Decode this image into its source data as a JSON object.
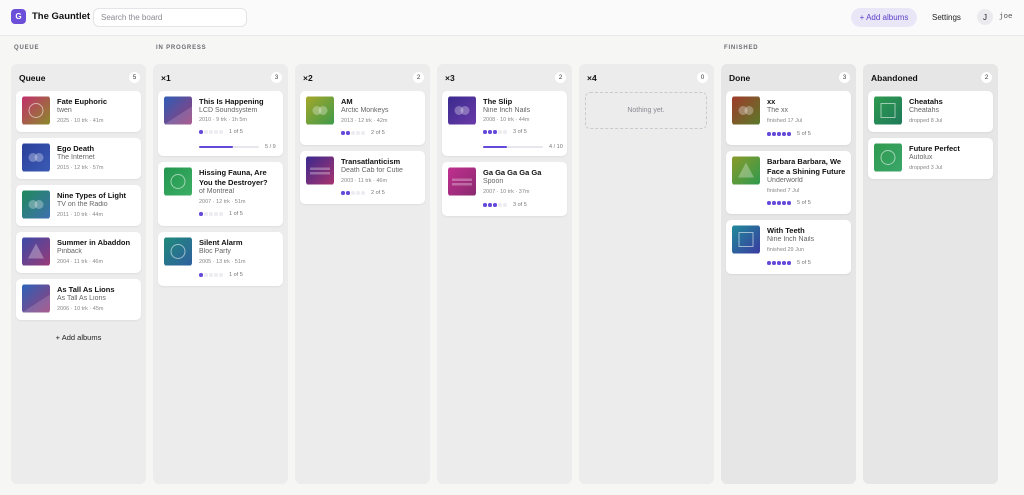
{
  "header": {
    "logo_letter": "G",
    "title": "The Gauntlet",
    "search_placeholder": "Search the board",
    "add_albums": "+ Add albums",
    "settings": "Settings",
    "avatar_letter": "J",
    "username": "joe"
  },
  "sections": {
    "queue": "QUEUE",
    "in_progress": "IN PROGRESS",
    "finished": "FINISHED"
  },
  "columns": {
    "queue": {
      "title": "Queue",
      "count": "5",
      "add_link": "+ Add albums",
      "cards": [
        {
          "title": "Fate Euphoric",
          "artist": "twen",
          "meta": "2025 · 10 trk · 41m"
        },
        {
          "title": "Ego Death",
          "artist": "The Internet",
          "meta": "2015 · 12 trk · 57m"
        },
        {
          "title": "Nine Types of Light",
          "artist": "TV on the Radio",
          "meta": "2011 · 10 trk · 44m"
        },
        {
          "title": "Summer in Abaddon",
          "artist": "Pinback",
          "meta": "2004 · 11 trk · 46m"
        },
        {
          "title": "As Tall As Lions",
          "artist": "As Tall As Lions",
          "meta": "2006 · 10 trk · 45m"
        }
      ]
    },
    "x1": {
      "title": "×1",
      "count": "3",
      "cards": [
        {
          "title": "This Is Happening",
          "artist": "LCD Soundsystem",
          "meta": "2010 · 9 trk · 1h 5m",
          "rating": 1,
          "rating_label": "1 of 5",
          "progress": 0.56,
          "progress_label": "5 / 9"
        },
        {
          "title": "Hissing Fauna, Are You the Destroyer?",
          "artist": "of Montreal",
          "meta": "2007 · 12 trk · 51m",
          "rating": 1,
          "rating_label": "1 of 5"
        },
        {
          "title": "Silent Alarm",
          "artist": "Bloc Party",
          "meta": "2005 · 13 trk · 51m",
          "rating": 1,
          "rating_label": "1 of 5"
        }
      ]
    },
    "x2": {
      "title": "×2",
      "count": "2",
      "cards": [
        {
          "title": "AM",
          "artist": "Arctic Monkeys",
          "meta": "2013 · 12 trk · 42m",
          "rating": 2,
          "rating_label": "2 of 5"
        },
        {
          "title": "Transatlanticism",
          "artist": "Death Cab for Cutie",
          "meta": "2003 · 11 trk · 46m",
          "rating": 2,
          "rating_label": "2 of 5"
        }
      ]
    },
    "x3": {
      "title": "×3",
      "count": "2",
      "cards": [
        {
          "title": "The Slip",
          "artist": "Nine Inch Nails",
          "meta": "2008 · 10 trk · 44m",
          "rating": 3,
          "rating_label": "3 of 5",
          "progress": 0.4,
          "progress_label": "4 / 10"
        },
        {
          "title": "Ga Ga Ga Ga Ga",
          "artist": "Spoon",
          "meta": "2007 · 10 trk · 37m",
          "rating": 3,
          "rating_label": "3 of 5"
        }
      ]
    },
    "x4": {
      "title": "×4",
      "count": "0",
      "empty_text": "Nothing yet."
    },
    "done": {
      "title": "Done",
      "count": "3",
      "cards": [
        {
          "title": "xx",
          "artist": "The xx",
          "meta": "finished 17 Jul",
          "rating": 5,
          "rating_label": "5 of 5"
        },
        {
          "title": "Barbara Barbara, We Face a Shining Future",
          "artist": "Underworld",
          "meta": "finished 7 Jul",
          "rating": 5,
          "rating_label": "5 of 5"
        },
        {
          "title": "With Teeth",
          "artist": "Nine Inch Nails",
          "meta": "finished 29 Jun",
          "rating": 5,
          "rating_label": "5 of 5"
        }
      ]
    },
    "abandoned": {
      "title": "Abandoned",
      "count": "2",
      "cards": [
        {
          "title": "Cheatahs",
          "artist": "Cheatahs",
          "meta": "dropped 8 Jul"
        },
        {
          "title": "Future Perfect",
          "artist": "Autolux",
          "meta": "dropped 3 Jul"
        }
      ]
    }
  },
  "colors": {
    "accent": "#6549d9",
    "accent_soft": "#e9e6f7"
  },
  "icons": {
    "logo": "app-logo",
    "art_circle": "circle-icon",
    "art_dual": "dual-circle-icon",
    "art_triangle": "triangle-icon",
    "art_square": "square-icon",
    "art_stripes": "stripes-icon"
  }
}
